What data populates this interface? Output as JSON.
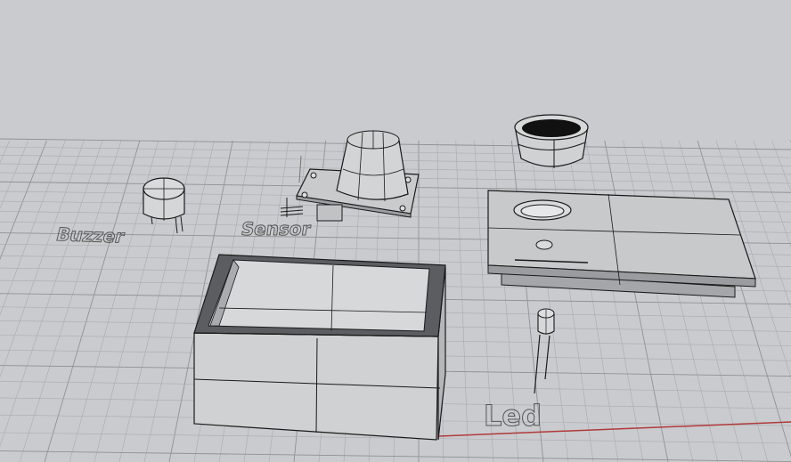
{
  "viewport": {
    "background": "#c9cbce",
    "grid_color": "#a8abaf",
    "grid_major_color": "#8f9296",
    "x_axis_color": "#b03a3a",
    "view": "perspective"
  },
  "objects": [
    {
      "name": "buzzer",
      "label": "Buzzer"
    },
    {
      "name": "sensor",
      "label": "Sensor"
    },
    {
      "name": "led",
      "label": "Led"
    },
    {
      "name": "lid-plate",
      "label": ""
    },
    {
      "name": "open-box",
      "label": ""
    },
    {
      "name": "cone-ring",
      "label": ""
    }
  ],
  "labels": {
    "buzzer": "Buzzer",
    "sensor": "Sensor",
    "led": "Led"
  },
  "colors": {
    "surface_light": "#d3d5d7",
    "surface_mid": "#b7b9bb",
    "surface_dark": "#8e9093",
    "edge": "#1a1a1a"
  }
}
